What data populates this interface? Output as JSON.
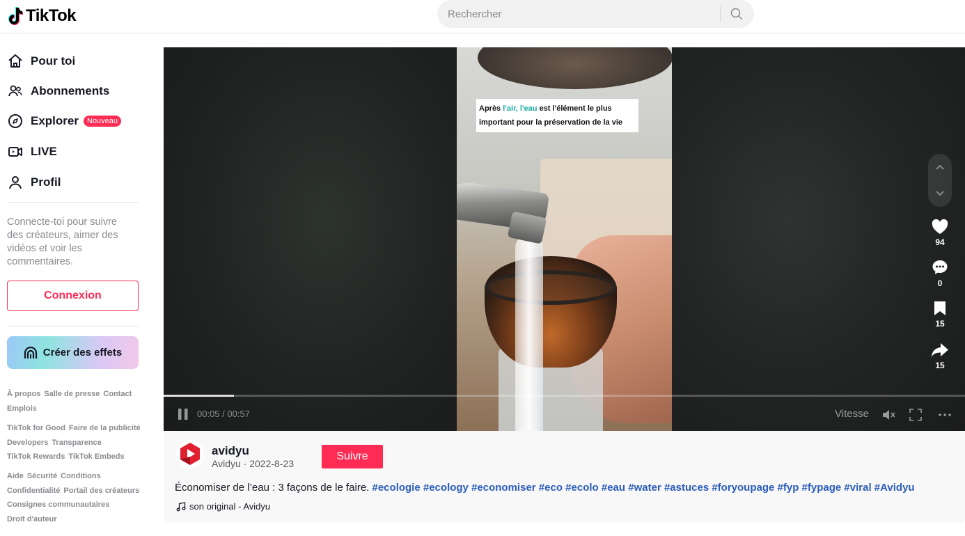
{
  "header": {
    "logo_text": "TikTok",
    "search_placeholder": "Rechercher"
  },
  "sidebar": {
    "nav": [
      {
        "label": "Pour toi",
        "icon": "home-icon"
      },
      {
        "label": "Abonnements",
        "icon": "following-icon"
      },
      {
        "label": "Explorer",
        "icon": "compass-icon",
        "badge": "Nouveau"
      },
      {
        "label": "LIVE",
        "icon": "live-icon"
      },
      {
        "label": "Profil",
        "icon": "profile-icon"
      }
    ],
    "login_message": "Connecte-toi pour suivre des créateurs, aimer des vidéos et voir les commentaires.",
    "login_button": "Connexion",
    "effects_button": "Créer des effets",
    "footer": {
      "group1": [
        "À propos",
        "Salle de presse",
        "Contact",
        "Emplois"
      ],
      "group2": [
        "TikTok for Good",
        "Faire de la publicité",
        "Developers",
        "Transparence",
        "TikTok Rewards",
        "TikTok Embeds"
      ],
      "group3": [
        "Aide",
        "Sécurité",
        "Conditions",
        "Confidentialité",
        "Portail des créateurs",
        "Consignes communautaires",
        "Droit d'auteur"
      ]
    }
  },
  "video": {
    "caption_line1_pre": "Après ",
    "caption_line1_hl": "l'air, l'eau",
    "caption_line1_post": " est l'élément le plus",
    "caption_line2": "important pour la préservation de la vie",
    "time": "00:05 / 00:57",
    "progress_fraction": 0.088,
    "speed_label": "Vitesse",
    "likes": "94",
    "comments": "0",
    "saves": "15",
    "shares": "15"
  },
  "post": {
    "author_name": "avidyu",
    "author_meta": "Avidyu · 2022-8-23",
    "follow_button": "Suivre",
    "description_text": "Économiser de l’eau : 3 façons de le faire. ",
    "hashtags": [
      "#ecologie",
      "#ecology",
      "#economiser",
      "#eco",
      "#ecolo",
      "#eau",
      "#water",
      "#astuces",
      "#foryoupage",
      "#fyp",
      "#fypage",
      "#viral",
      "#Avidyu"
    ],
    "music": "son original - Avidyu"
  },
  "colors": {
    "brand": "#fe2c55",
    "hashtag": "#2b5db9",
    "caption_highlight": "#1aa9a3"
  }
}
